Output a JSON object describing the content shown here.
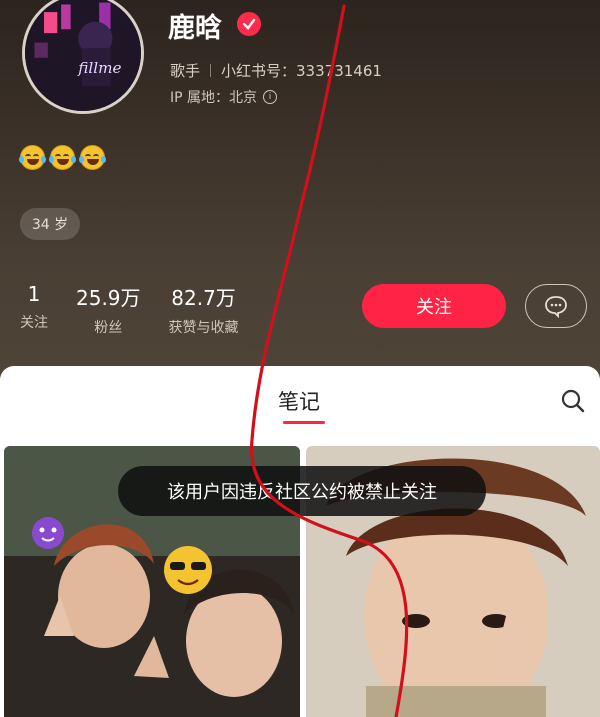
{
  "profile": {
    "name": "鹿晗",
    "occupation": "歌手",
    "redbook_id": "小红书号：333731461",
    "ip_location": "IP 属地：北京",
    "age": "34 岁",
    "bio_icons": [
      "laughing-tears-emoji",
      "laughing-tears-emoji",
      "laughing-tears-emoji"
    ],
    "avatar_text": "fillme"
  },
  "stats": [
    {
      "value": "1",
      "label": "关注"
    },
    {
      "value": "25.9万",
      "label": "粉丝"
    },
    {
      "value": "82.7万",
      "label": "获赞与收藏"
    }
  ],
  "actions": {
    "follow_label": "关注",
    "message_icon": "chat-bubble-icon"
  },
  "tabs": {
    "notes_label": "笔记"
  },
  "toast": {
    "message": "该用户因违反社区公约被禁止关注"
  },
  "colors": {
    "accent": "#ff2446",
    "annotation_line": "#d40f1c"
  }
}
